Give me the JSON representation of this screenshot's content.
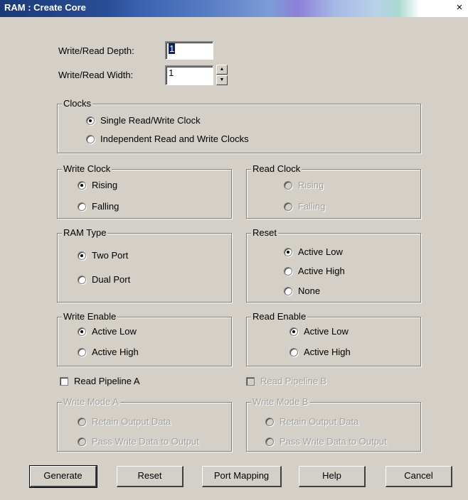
{
  "window": {
    "title": "RAM : Create Core",
    "close_glyph": "×"
  },
  "depth": {
    "label": "Write/Read Depth:",
    "value": "1"
  },
  "width": {
    "label": "Write/Read Width:",
    "value": "1",
    "spin_up": "▲",
    "spin_down": "▼"
  },
  "clocks": {
    "label": "Clocks",
    "options": [
      "Single Read/Write Clock",
      "Independent Read and Write Clocks"
    ],
    "selected": "Single Read/Write Clock"
  },
  "write_clock": {
    "label": "Write Clock",
    "options": [
      "Rising",
      "Falling"
    ],
    "selected": "Rising"
  },
  "read_clock": {
    "label": "Read Clock",
    "options": [
      "Rising",
      "Falling"
    ],
    "disabled": true
  },
  "ram_type": {
    "label": "RAM Type",
    "options": [
      "Two Port",
      "Dual Port"
    ],
    "selected": "Two Port"
  },
  "reset": {
    "label": "Reset",
    "options": [
      "Active Low",
      "Active High",
      "None"
    ],
    "selected": "Active Low"
  },
  "write_enable": {
    "label": "Write Enable",
    "options": [
      "Active Low",
      "Active High"
    ],
    "selected": "Active Low"
  },
  "read_enable": {
    "label": "Read Enable",
    "options": [
      "Active Low",
      "Active High"
    ],
    "selected": "Active Low"
  },
  "read_pipeline_a": {
    "label": "Read Pipeline A",
    "checked": false
  },
  "read_pipeline_b": {
    "label": "Read Pipeline B",
    "checked": false,
    "disabled": true
  },
  "write_mode_a": {
    "label": "Write Mode A",
    "options": [
      "Retain Output Data",
      "Pass Write Data to Output"
    ],
    "disabled": true
  },
  "write_mode_b": {
    "label": "Write Mode B",
    "options": [
      "Retain Output Data",
      "Pass Write Data to Output"
    ],
    "disabled": true
  },
  "buttons": {
    "generate": "Generate",
    "reset": "Reset",
    "port_mapping": "Port Mapping",
    "help": "Help",
    "cancel": "Cancel"
  },
  "colors": {
    "dialog_bg": "#d4d0c8",
    "titlebar_start": "#1a3a78",
    "selection": "#0a246a",
    "disabled_text": "#a0a0a0"
  }
}
